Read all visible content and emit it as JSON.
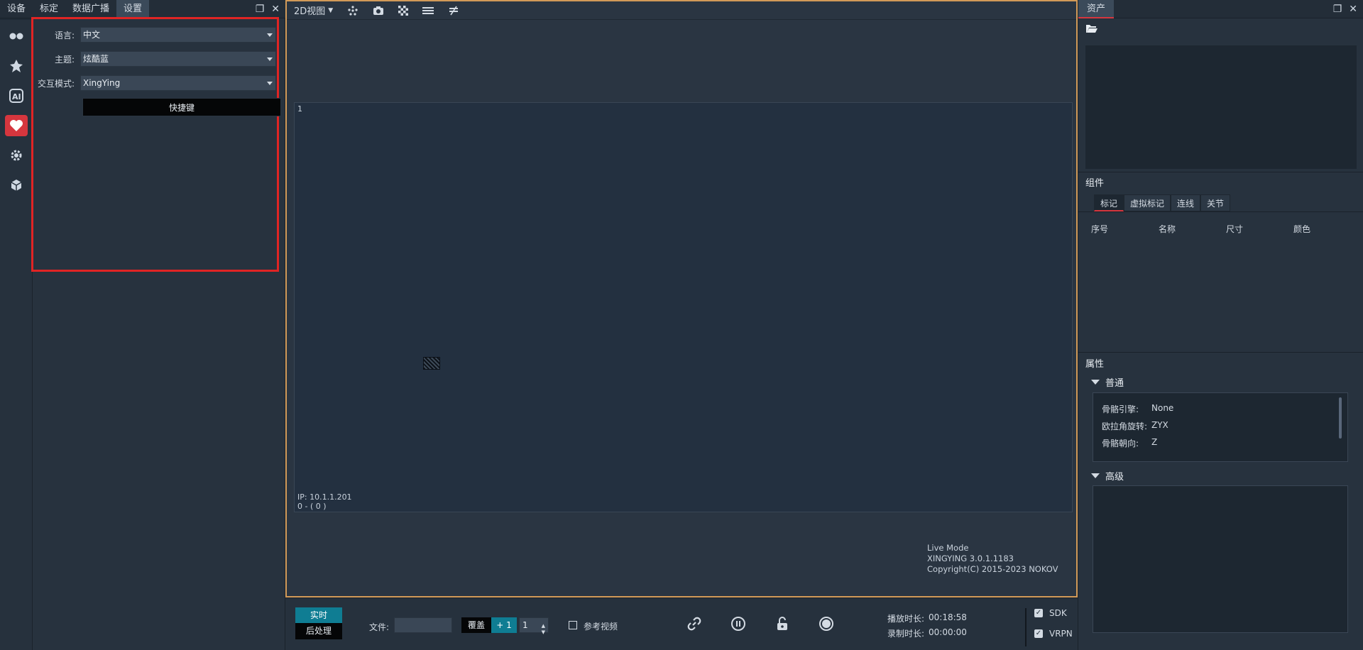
{
  "left_tabs": [
    "设备",
    "标定",
    "数据广播",
    "设置"
  ],
  "settings": {
    "language": {
      "label": "语言:",
      "value": "中文"
    },
    "theme": {
      "label": "主题:",
      "value": "炫酷蓝"
    },
    "interaction": {
      "label": "交互模式:",
      "value": "XingYing"
    },
    "shortcut_label": "快捷键"
  },
  "icon_bar": [
    "devices-icon",
    "calibration-icon",
    "ai-icon",
    "favorites-icon",
    "settings-gear-icon",
    "asset-cube-icon"
  ],
  "view": {
    "mode_label": "2D视图",
    "camera_id": "1",
    "ip": "IP: 10.1.1.201",
    "frame": "0 - ( 0 )",
    "live_mode": "Live Mode",
    "version": "XINGYING 3.0.1.1183",
    "copyright": "Copyright(C) 2015-2023 NOKOV"
  },
  "bottom": {
    "realtime_label": "实时",
    "postprocess_label": "后处理",
    "file_label": "文件:",
    "overlay_label": "覆盖",
    "plus_one": "+ 1",
    "spin_value": "1",
    "ref_video_label": "参考视频",
    "play_duration_label": "播放时长:",
    "play_duration": "00:18:58",
    "record_duration_label": "录制时长:",
    "record_duration": "00:00:00",
    "sdk_label": "SDK",
    "vrpn_label": "VRPN"
  },
  "right": {
    "assets_tab": "资产",
    "components_title": "组件",
    "component_tabs": [
      "标记",
      "虚拟标记",
      "连线",
      "关节"
    ],
    "columns": [
      "序号",
      "名称",
      "尺寸",
      "颜色"
    ],
    "properties_title": "属性",
    "general_group": "普通",
    "advanced_group": "高级",
    "props": [
      {
        "k": "骨骼引擎:",
        "v": "None"
      },
      {
        "k": "欧拉角旋转:",
        "v": "ZYX"
      },
      {
        "k": "骨骼朝向:",
        "v": "Z"
      }
    ]
  }
}
